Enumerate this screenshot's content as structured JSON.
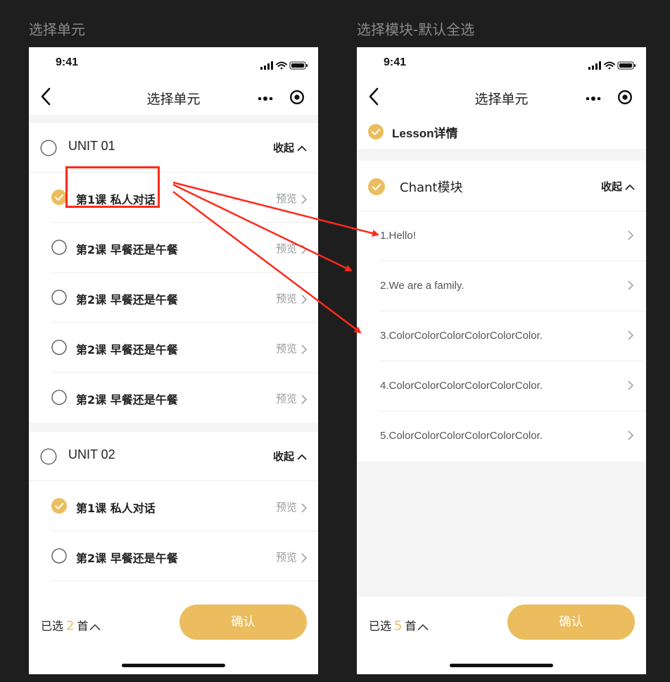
{
  "board": {
    "left_label": "选择单元",
    "right_label": "选择模块-默认全选"
  },
  "left": {
    "status_time": "9:41",
    "nav_title": "选择单元",
    "units": [
      {
        "title": "UNIT 01",
        "checked": false,
        "collapse_label": "收起",
        "lessons": [
          {
            "title": "第1课 私人对话",
            "checked": true,
            "preview": "预览"
          },
          {
            "title": "第2课 早餐还是午餐",
            "checked": false,
            "preview": "预览"
          },
          {
            "title": "第2课 早餐还是午餐",
            "checked": false,
            "preview": "预览"
          },
          {
            "title": "第2课 早餐还是午餐",
            "checked": false,
            "preview": "预览"
          },
          {
            "title": "第2课 早餐还是午餐",
            "checked": false,
            "preview": "预览"
          }
        ]
      },
      {
        "title": "UNIT 02",
        "checked": false,
        "collapse_label": "收起",
        "lessons": [
          {
            "title": "第1课 私人对话",
            "checked": true,
            "preview": "预览"
          },
          {
            "title": "第2课 早餐还是午餐",
            "checked": false,
            "preview": "预览"
          }
        ]
      }
    ],
    "bottom": {
      "selected_prefix": "已选",
      "selected_count": "2",
      "selected_suffix": "首",
      "confirm_label": "确认"
    }
  },
  "right": {
    "status_time": "9:41",
    "nav_title": "选择单元",
    "lesson_detail": {
      "label": "Lesson详情",
      "checked": true
    },
    "chant": {
      "title": "Chant模块",
      "checked": true,
      "collapse_label": "收起",
      "items": [
        "1.Hello!",
        "2.We are a family.",
        "3.ColorColorColorColorColorColor.",
        "4.ColorColorColorColorColorColor.",
        "5.ColorColorColorColorColorColor."
      ]
    },
    "bottom": {
      "selected_prefix": "已选",
      "selected_count": "5",
      "selected_suffix": "首",
      "confirm_label": "确认"
    }
  },
  "colors": {
    "accent": "#ebbd5e",
    "annotation_red": "#ff2a1a",
    "background": "#1e1e1e"
  }
}
